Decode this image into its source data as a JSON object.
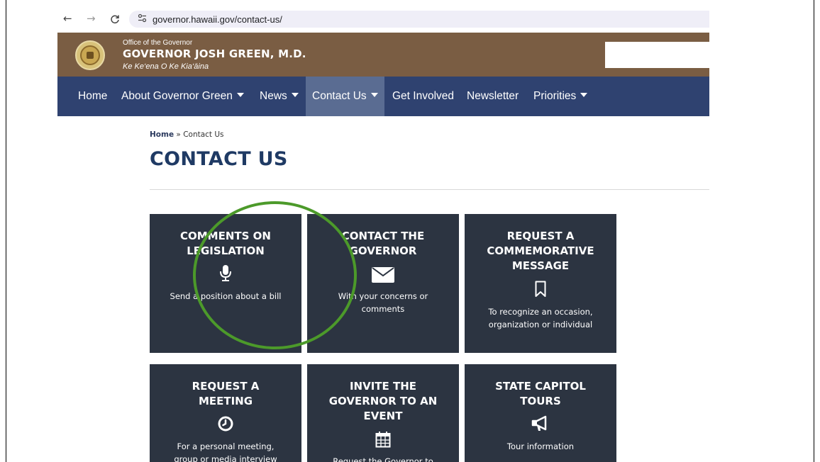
{
  "browser": {
    "url": "governor.hawaii.gov/contact-us/",
    "back_icon": "arrow-left-icon",
    "forward_icon": "arrow-right-icon",
    "reload_icon": "reload-icon",
    "site_info_icon": "tune-icon"
  },
  "header": {
    "office": "Office of the Governor",
    "name": "GOVERNOR JOSH GREEN, M.D.",
    "tagline": "Ke Ke‘ena O Ke Kia‘āina",
    "seal_icon": "state-seal-icon",
    "background_color": "#7a5d43"
  },
  "nav": {
    "background_color": "#2f4270",
    "items": [
      {
        "label": "Home"
      },
      {
        "label": "About Governor Green"
      },
      {
        "label": "News"
      },
      {
        "label": "Contact Us"
      },
      {
        "label": "Get Involved"
      },
      {
        "label": "Newsletter"
      },
      {
        "label": "Priorities"
      }
    ]
  },
  "breadcrumb": {
    "home": "Home",
    "separator": " » ",
    "current": "Contact Us"
  },
  "page": {
    "title": "CONTACT US"
  },
  "tiles": [
    {
      "title_lines": [
        "COMMENTS ON",
        "LEGISLATION"
      ],
      "icon": "microphone-icon",
      "desc_lines": [
        "Send a position about a bill"
      ]
    },
    {
      "title_lines": [
        "CONTACT THE",
        "GOVERNOR"
      ],
      "icon": "envelope-icon",
      "desc_lines": [
        "With your concerns or",
        "comments"
      ]
    },
    {
      "title_lines": [
        "REQUEST A",
        "COMMEMORATIVE",
        "MESSAGE"
      ],
      "icon": "bookmark-icon",
      "desc_lines": [
        "To recognize an occasion,",
        "organization or individual"
      ]
    },
    {
      "title_lines": [
        "REQUEST A",
        "MEETING"
      ],
      "icon": "clock-icon",
      "desc_lines": [
        "For a personal meeting,",
        "group or media interview"
      ]
    },
    {
      "title_lines": [
        "INVITE THE",
        "GOVERNOR TO AN",
        "EVENT"
      ],
      "icon": "calendar-icon",
      "desc_lines": [
        "Request the Governor to"
      ]
    },
    {
      "title_lines": [
        "STATE CAPITOL",
        "TOURS"
      ],
      "icon": "megaphone-icon",
      "desc_lines": [
        "Tour information"
      ]
    }
  ],
  "annotation": {
    "highlight_color": "#4c9a2a"
  }
}
